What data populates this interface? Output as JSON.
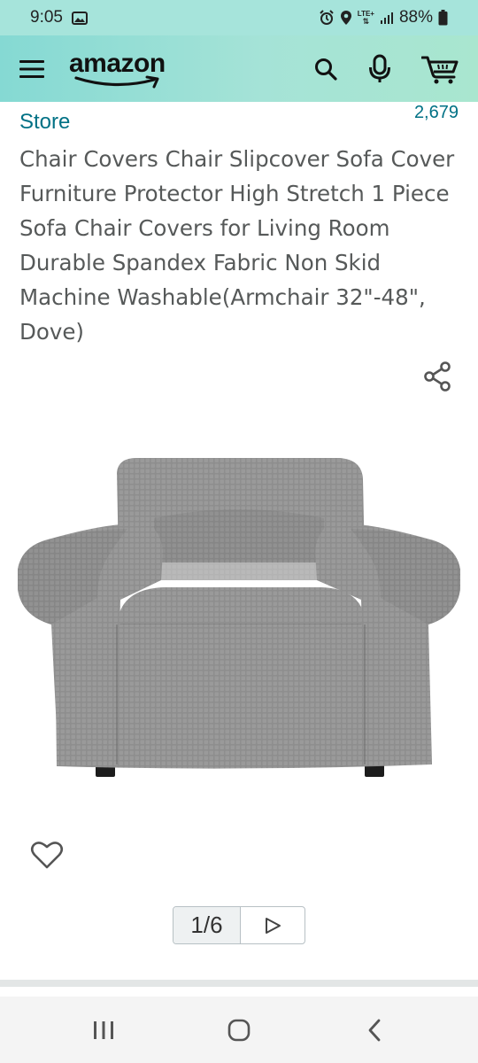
{
  "status_bar": {
    "time": "9:05",
    "lte": "LTE+",
    "battery": "88%",
    "icons": [
      "image-icon",
      "alarm-icon",
      "location-icon",
      "lte-icon",
      "signal-icon",
      "battery-icon"
    ]
  },
  "header": {
    "logo_text": "amazon",
    "icons": [
      "menu-icon",
      "search-icon",
      "microphone-icon",
      "cart-icon"
    ]
  },
  "product": {
    "store_link": "Store",
    "ratings_count": "2,679",
    "title": "Chair Covers Chair Slipcover Sofa Cover Furniture Protector High Stretch 1 Piece Sofa Chair Covers for Living Room Durable Spandex Fabric Non Skid Machine Washable(Armchair 32\"-48\", Dove)",
    "image_alt": "gray armchair slipcover",
    "pager": {
      "current": 1,
      "total": 6,
      "label": "1/6"
    }
  },
  "colors": {
    "header_start": "#85d9d3",
    "header_end": "#a9e6cf",
    "link": "#007185",
    "title": "#565959",
    "fabric": "#8c8c8c"
  },
  "nav_bar": {
    "icons": [
      "recents-icon",
      "home-icon",
      "back-icon"
    ]
  }
}
